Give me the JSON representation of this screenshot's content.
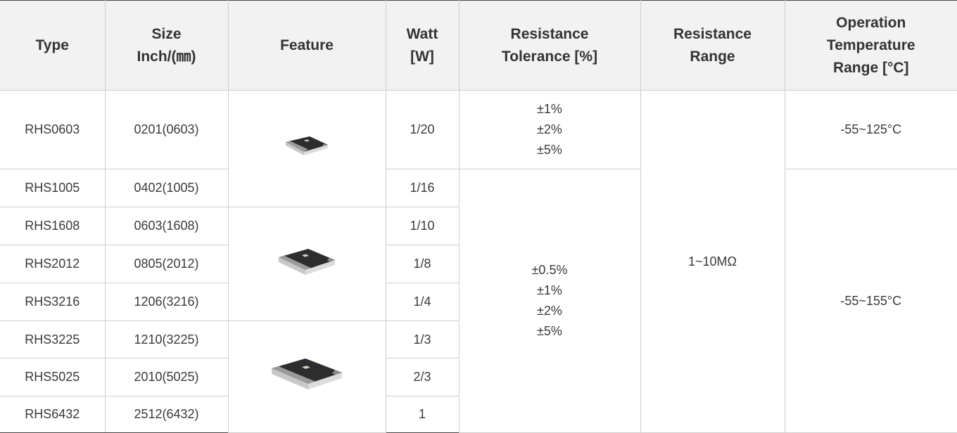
{
  "headers": {
    "type": [
      "Type"
    ],
    "size": [
      "Size",
      "Inch/(㎜)"
    ],
    "feature": [
      "Feature"
    ],
    "watt": [
      "Watt",
      "[W]"
    ],
    "tolerance": [
      "Resistance",
      "Tolerance [%]"
    ],
    "range": [
      "Resistance",
      "Range"
    ],
    "temperature": [
      "Operation",
      "Temperature",
      "Range [°C]"
    ]
  },
  "rows": [
    {
      "type": "RHS0603",
      "size": "0201(0603)",
      "watt": "1/20"
    },
    {
      "type": "RHS1005",
      "size": "0402(1005)",
      "watt": "1/16"
    },
    {
      "type": "RHS1608",
      "size": "0603(1608)",
      "watt": "1/10"
    },
    {
      "type": "RHS2012",
      "size": "0805(2012)",
      "watt": "1/8"
    },
    {
      "type": "RHS3216",
      "size": "1206(3216)",
      "watt": "1/4"
    },
    {
      "type": "RHS3225",
      "size": "1210(3225)",
      "watt": "1/3"
    },
    {
      "type": "RHS5025",
      "size": "2010(5025)",
      "watt": "2/3"
    },
    {
      "type": "RHS6432",
      "size": "2512(6432)",
      "watt": "1"
    }
  ],
  "tolerance_groups": [
    [
      "±1%",
      "±2%",
      "±5%"
    ],
    [
      "±0.5%",
      "±1%",
      "±2%",
      "±5%"
    ]
  ],
  "resistance_range": "1~10MΩ",
  "temperature_groups": [
    "-55~125°C",
    "-55~155°C"
  ],
  "features": [
    {
      "icon": "small-chip-resistor-image"
    },
    {
      "icon": "medium-chip-resistor-image"
    },
    {
      "icon": "large-chip-resistor-image"
    }
  ]
}
